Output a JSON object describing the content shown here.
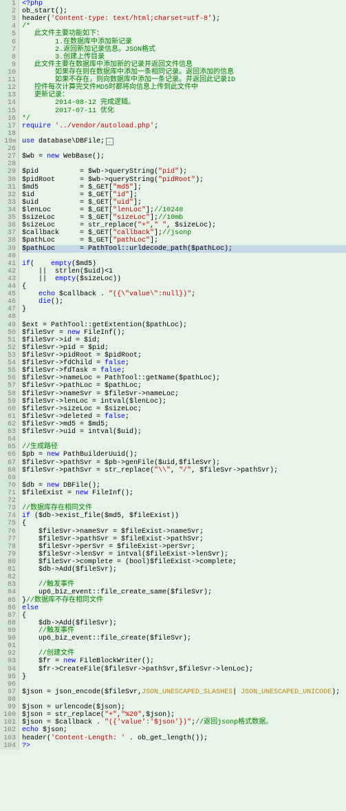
{
  "lines": [
    {
      "n": "1",
      "c": [
        {
          "t": "<?php",
          "s": "kw"
        }
      ]
    },
    {
      "n": "2",
      "c": [
        {
          "t": "ob_start();",
          "s": ""
        }
      ]
    },
    {
      "n": "3",
      "c": [
        {
          "t": "header(",
          "s": ""
        },
        {
          "t": "'Content-type: text/html;charset=utf-8'",
          "s": "str"
        },
        {
          "t": ");",
          "s": ""
        }
      ]
    },
    {
      "n": "4",
      "c": [
        {
          "t": "/*",
          "s": "com"
        }
      ]
    },
    {
      "n": "5",
      "c": [
        {
          "t": "   此文件主要功能如下：",
          "s": "com"
        }
      ]
    },
    {
      "n": "6",
      "c": [
        {
          "t": "        1.在数据库中添加新记录",
          "s": "com"
        }
      ]
    },
    {
      "n": "7",
      "c": [
        {
          "t": "        2.返回新加记录信息。JSON格式",
          "s": "com"
        }
      ]
    },
    {
      "n": "8",
      "c": [
        {
          "t": "        3.创建上传目录",
          "s": "com"
        }
      ]
    },
    {
      "n": "9",
      "c": [
        {
          "t": "   此文件主要在数据库中添加新的记录并返回文件信息",
          "s": "com"
        }
      ]
    },
    {
      "n": "10",
      "c": [
        {
          "t": "        如果存在则在数据库中添加一条相同记录。返回添加的信息",
          "s": "com"
        }
      ]
    },
    {
      "n": "11",
      "c": [
        {
          "t": "        如果不存在，则向数据库中添加一条记录。并返回此记录ID",
          "s": "com"
        }
      ]
    },
    {
      "n": "12",
      "c": [
        {
          "t": "   控件每次计算完文件MD5时都将向信息上传到此文件中",
          "s": "com"
        }
      ]
    },
    {
      "n": "13",
      "c": [
        {
          "t": "   更新记录：",
          "s": "com"
        }
      ]
    },
    {
      "n": "14",
      "c": [
        {
          "t": "        2014-08-12 完成逻辑。",
          "s": "com"
        }
      ]
    },
    {
      "n": "15",
      "c": [
        {
          "t": "        2017-07-11 优化",
          "s": "com"
        }
      ]
    },
    {
      "n": "16",
      "c": [
        {
          "t": "*/",
          "s": "com"
        }
      ]
    },
    {
      "n": "17",
      "c": [
        {
          "t": "require",
          "s": "kw"
        },
        {
          "t": " ",
          "s": ""
        },
        {
          "t": "'../vendor/autoload.php'",
          "s": "str"
        },
        {
          "t": ";",
          "s": ""
        }
      ]
    },
    {
      "n": "18",
      "c": []
    },
    {
      "n": "19",
      "fold": true,
      "c": [
        {
          "t": "use",
          "s": "kw"
        },
        {
          "t": " database\\DBFile;",
          "s": ""
        }
      ]
    },
    {
      "n": "26",
      "c": []
    },
    {
      "n": "27",
      "c": [
        {
          "t": "$wb = ",
          "s": ""
        },
        {
          "t": "new",
          "s": "kw"
        },
        {
          "t": " WebBase();",
          "s": ""
        }
      ]
    },
    {
      "n": "28",
      "c": []
    },
    {
      "n": "29",
      "c": [
        {
          "t": "$pid          = $wb->queryString(",
          "s": ""
        },
        {
          "t": "\"pid\"",
          "s": "str"
        },
        {
          "t": ");",
          "s": ""
        }
      ]
    },
    {
      "n": "30",
      "c": [
        {
          "t": "$pidRoot      = $wb->queryString(",
          "s": ""
        },
        {
          "t": "\"pidRoot\"",
          "s": "str"
        },
        {
          "t": ");",
          "s": ""
        }
      ]
    },
    {
      "n": "31",
      "c": [
        {
          "t": "$md5          = $_GET[",
          "s": ""
        },
        {
          "t": "\"md5\"",
          "s": "str"
        },
        {
          "t": "];",
          "s": ""
        }
      ]
    },
    {
      "n": "32",
      "c": [
        {
          "t": "$id           = $_GET[",
          "s": ""
        },
        {
          "t": "\"id\"",
          "s": "str"
        },
        {
          "t": "];",
          "s": ""
        }
      ]
    },
    {
      "n": "33",
      "c": [
        {
          "t": "$uid          = $_GET[",
          "s": ""
        },
        {
          "t": "\"uid\"",
          "s": "str"
        },
        {
          "t": "];",
          "s": ""
        }
      ]
    },
    {
      "n": "34",
      "c": [
        {
          "t": "$lenLoc       = $_GET[",
          "s": ""
        },
        {
          "t": "\"lenLoc\"",
          "s": "str"
        },
        {
          "t": "];",
          "s": ""
        },
        {
          "t": "//10240",
          "s": "com"
        }
      ]
    },
    {
      "n": "35",
      "c": [
        {
          "t": "$sizeLoc      = $_GET[",
          "s": ""
        },
        {
          "t": "\"sizeLoc\"",
          "s": "str"
        },
        {
          "t": "];",
          "s": ""
        },
        {
          "t": "//10mb",
          "s": "com"
        }
      ]
    },
    {
      "n": "36",
      "c": [
        {
          "t": "$sizeLoc      = str_replace(",
          "s": ""
        },
        {
          "t": "\"+\"",
          "s": "str"
        },
        {
          "t": ",",
          "s": ""
        },
        {
          "t": "\" \"",
          "s": "str"
        },
        {
          "t": ", $sizeLoc);",
          "s": ""
        }
      ]
    },
    {
      "n": "37",
      "c": [
        {
          "t": "$callback     = $_GET[",
          "s": ""
        },
        {
          "t": "\"callback\"",
          "s": "str"
        },
        {
          "t": "];",
          "s": ""
        },
        {
          "t": "//jsonp",
          "s": "com"
        }
      ]
    },
    {
      "n": "38",
      "c": [
        {
          "t": "$pathLoc      = $_GET[",
          "s": ""
        },
        {
          "t": "\"pathLoc\"",
          "s": "str"
        },
        {
          "t": "];",
          "s": ""
        }
      ]
    },
    {
      "n": "39",
      "hl": true,
      "c": [
        {
          "t": "$pathLoc      = PathTool::urldecode_path($pathLoc);",
          "s": ""
        }
      ]
    },
    {
      "n": "40",
      "c": []
    },
    {
      "n": "41",
      "c": [
        {
          "t": "if",
          "s": "kw"
        },
        {
          "t": "(    ",
          "s": ""
        },
        {
          "t": "empty",
          "s": "kw"
        },
        {
          "t": "($md5)",
          "s": ""
        }
      ]
    },
    {
      "n": "42",
      "c": [
        {
          "t": "    ||  strlen($uid)<1",
          "s": ""
        }
      ]
    },
    {
      "n": "43",
      "c": [
        {
          "t": "    ||  ",
          "s": ""
        },
        {
          "t": "empty",
          "s": "kw"
        },
        {
          "t": "($sizeLoc))",
          "s": ""
        }
      ]
    },
    {
      "n": "44",
      "c": [
        {
          "t": "{",
          "s": ""
        }
      ]
    },
    {
      "n": "45",
      "c": [
        {
          "t": "    ",
          "s": ""
        },
        {
          "t": "echo",
          "s": "kw"
        },
        {
          "t": " $callback . ",
          "s": ""
        },
        {
          "t": "\"({\\\"value\\\":null})\"",
          "s": "str"
        },
        {
          "t": ";",
          "s": ""
        }
      ]
    },
    {
      "n": "46",
      "c": [
        {
          "t": "    ",
          "s": ""
        },
        {
          "t": "die",
          "s": "kw"
        },
        {
          "t": "();",
          "s": ""
        }
      ]
    },
    {
      "n": "47",
      "c": [
        {
          "t": "}",
          "s": ""
        }
      ]
    },
    {
      "n": "48",
      "c": []
    },
    {
      "n": "49",
      "c": [
        {
          "t": "$ext = PathTool::getExtention($pathLoc);",
          "s": ""
        }
      ]
    },
    {
      "n": "50",
      "c": [
        {
          "t": "$fileSvr = ",
          "s": ""
        },
        {
          "t": "new",
          "s": "kw"
        },
        {
          "t": " FileInf();",
          "s": ""
        }
      ]
    },
    {
      "n": "51",
      "c": [
        {
          "t": "$fileSvr->id = $id;",
          "s": ""
        }
      ]
    },
    {
      "n": "52",
      "c": [
        {
          "t": "$fileSvr->pid = $pid;",
          "s": ""
        }
      ]
    },
    {
      "n": "53",
      "c": [
        {
          "t": "$fileSvr->pidRoot = $pidRoot;",
          "s": ""
        }
      ]
    },
    {
      "n": "54",
      "c": [
        {
          "t": "$fileSvr->fdChild = ",
          "s": ""
        },
        {
          "t": "false",
          "s": "kw"
        },
        {
          "t": ";",
          "s": ""
        }
      ]
    },
    {
      "n": "55",
      "c": [
        {
          "t": "$fileSvr->fdTask = ",
          "s": ""
        },
        {
          "t": "false",
          "s": "kw"
        },
        {
          "t": ";",
          "s": ""
        }
      ]
    },
    {
      "n": "56",
      "c": [
        {
          "t": "$fileSvr->nameLoc = PathTool::getName($pathLoc);",
          "s": ""
        }
      ]
    },
    {
      "n": "57",
      "c": [
        {
          "t": "$fileSvr->pathLoc = $pathLoc;",
          "s": ""
        }
      ]
    },
    {
      "n": "58",
      "c": [
        {
          "t": "$fileSvr->nameSvr = $fileSvr->nameLoc;",
          "s": ""
        }
      ]
    },
    {
      "n": "59",
      "c": [
        {
          "t": "$fileSvr->lenLoc = intval($lenLoc);",
          "s": ""
        }
      ]
    },
    {
      "n": "60",
      "c": [
        {
          "t": "$fileSvr->sizeLoc = $sizeLoc;",
          "s": ""
        }
      ]
    },
    {
      "n": "61",
      "c": [
        {
          "t": "$fileSvr->deleted = ",
          "s": ""
        },
        {
          "t": "false",
          "s": "kw"
        },
        {
          "t": ";",
          "s": ""
        }
      ]
    },
    {
      "n": "62",
      "c": [
        {
          "t": "$fileSvr->md5 = $md5;",
          "s": ""
        }
      ]
    },
    {
      "n": "63",
      "c": [
        {
          "t": "$fileSvr->uid = intval($uid);",
          "s": ""
        }
      ]
    },
    {
      "n": "64",
      "c": []
    },
    {
      "n": "65",
      "c": [
        {
          "t": "//生成路径",
          "s": "com"
        }
      ]
    },
    {
      "n": "66",
      "c": [
        {
          "t": "$pb = ",
          "s": ""
        },
        {
          "t": "new",
          "s": "kw"
        },
        {
          "t": " PathBuilderUuid();",
          "s": ""
        }
      ]
    },
    {
      "n": "67",
      "c": [
        {
          "t": "$fileSvr->pathSvr = $pb->genFile($uid,$fileSvr);",
          "s": ""
        }
      ]
    },
    {
      "n": "68",
      "c": [
        {
          "t": "$fileSvr->pathSvr = str_replace(",
          "s": ""
        },
        {
          "t": "\"\\\\\"",
          "s": "str"
        },
        {
          "t": ", ",
          "s": ""
        },
        {
          "t": "\"/\"",
          "s": "str"
        },
        {
          "t": ", $fileSvr->pathSvr);",
          "s": ""
        }
      ]
    },
    {
      "n": "69",
      "c": []
    },
    {
      "n": "70",
      "c": [
        {
          "t": "$db = ",
          "s": ""
        },
        {
          "t": "new",
          "s": "kw"
        },
        {
          "t": " DBFile();",
          "s": ""
        }
      ]
    },
    {
      "n": "71",
      "c": [
        {
          "t": "$fileExist = ",
          "s": ""
        },
        {
          "t": "new",
          "s": "kw"
        },
        {
          "t": " FileInf();",
          "s": ""
        }
      ]
    },
    {
      "n": "72",
      "c": []
    },
    {
      "n": "73",
      "c": [
        {
          "t": "//数据库存在相同文件",
          "s": "com"
        }
      ]
    },
    {
      "n": "74",
      "c": [
        {
          "t": "if",
          "s": "kw"
        },
        {
          "t": " ($db->exist_file($md5, $fileExist))",
          "s": ""
        }
      ]
    },
    {
      "n": "75",
      "c": [
        {
          "t": "{",
          "s": ""
        }
      ]
    },
    {
      "n": "76",
      "c": [
        {
          "t": "    $fileSvr->nameSvr = $fileExist->nameSvr;",
          "s": ""
        }
      ]
    },
    {
      "n": "77",
      "c": [
        {
          "t": "    $fileSvr->pathSvr = $fileExist->pathSvr;",
          "s": ""
        }
      ]
    },
    {
      "n": "78",
      "c": [
        {
          "t": "    $fileSvr->perSvr = $fileExist->perSvr;",
          "s": ""
        }
      ]
    },
    {
      "n": "79",
      "c": [
        {
          "t": "    $fileSvr->lenSvr = intval($fileExist->lenSvr);",
          "s": ""
        }
      ]
    },
    {
      "n": "80",
      "c": [
        {
          "t": "    $fileSvr->complete = (bool)$fileExist->complete;",
          "s": ""
        }
      ]
    },
    {
      "n": "81",
      "c": [
        {
          "t": "    $db->Add($fileSvr);",
          "s": ""
        }
      ]
    },
    {
      "n": "82",
      "c": []
    },
    {
      "n": "83",
      "c": [
        {
          "t": "    ",
          "s": ""
        },
        {
          "t": "//触发事件",
          "s": "com"
        }
      ]
    },
    {
      "n": "84",
      "c": [
        {
          "t": "    up6_biz_event::file_create_same($fileSvr);",
          "s": ""
        }
      ]
    },
    {
      "n": "85",
      "c": [
        {
          "t": "}",
          "s": ""
        },
        {
          "t": "//数据库不存在相同文件",
          "s": "com"
        }
      ]
    },
    {
      "n": "86",
      "c": [
        {
          "t": "else",
          "s": "kw"
        }
      ]
    },
    {
      "n": "87",
      "c": [
        {
          "t": "{",
          "s": ""
        }
      ]
    },
    {
      "n": "88",
      "c": [
        {
          "t": "    $db->Add($fileSvr);",
          "s": ""
        }
      ]
    },
    {
      "n": "89",
      "c": [
        {
          "t": "    ",
          "s": ""
        },
        {
          "t": "//触发事件",
          "s": "com"
        }
      ]
    },
    {
      "n": "90",
      "c": [
        {
          "t": "    up6_biz_event::file_create($fileSvr);",
          "s": ""
        }
      ]
    },
    {
      "n": "91",
      "c": []
    },
    {
      "n": "92",
      "c": [
        {
          "t": "    ",
          "s": ""
        },
        {
          "t": "//创建文件",
          "s": "com"
        }
      ]
    },
    {
      "n": "93",
      "c": [
        {
          "t": "    $fr = ",
          "s": ""
        },
        {
          "t": "new",
          "s": "kw"
        },
        {
          "t": " FileBlockWriter();",
          "s": ""
        }
      ]
    },
    {
      "n": "94",
      "c": [
        {
          "t": "    $fr->CreateFile($fileSvr->pathSvr,$fileSvr->lenLoc);",
          "s": ""
        }
      ]
    },
    {
      "n": "95",
      "c": [
        {
          "t": "}",
          "s": ""
        }
      ]
    },
    {
      "n": "96",
      "c": []
    },
    {
      "n": "97",
      "c": [
        {
          "t": "$json = json_encode($fileSvr,",
          "s": ""
        },
        {
          "t": "JSON_UNESCAPED_SLASHES",
          "s": "cc"
        },
        {
          "t": "| ",
          "s": ""
        },
        {
          "t": "JSON_UNESCAPED_UNICODE",
          "s": "cc"
        },
        {
          "t": ");",
          "s": ""
        }
      ]
    },
    {
      "n": "98",
      "c": []
    },
    {
      "n": "99",
      "c": [
        {
          "t": "$json = urlencode($json);",
          "s": ""
        }
      ]
    },
    {
      "n": "100",
      "c": [
        {
          "t": "$json = str_replace(",
          "s": ""
        },
        {
          "t": "\"+\"",
          "s": "str"
        },
        {
          "t": ",",
          "s": ""
        },
        {
          "t": "\"%20\"",
          "s": "str"
        },
        {
          "t": ",$json);",
          "s": ""
        }
      ]
    },
    {
      "n": "101",
      "c": [
        {
          "t": "$json = $callback . ",
          "s": ""
        },
        {
          "t": "\"({'value':'$json'})\"",
          "s": "str"
        },
        {
          "t": ";",
          "s": ""
        },
        {
          "t": "//返回jsonp格式数据。",
          "s": "com"
        }
      ]
    },
    {
      "n": "102",
      "c": [
        {
          "t": "echo",
          "s": "kw"
        },
        {
          "t": " $json;",
          "s": ""
        }
      ]
    },
    {
      "n": "103",
      "c": [
        {
          "t": "header(",
          "s": ""
        },
        {
          "t": "'Content-Length: '",
          "s": "str"
        },
        {
          "t": " . ob_get_length());",
          "s": ""
        }
      ]
    },
    {
      "n": "104",
      "c": [
        {
          "t": "?>",
          "s": "kw"
        }
      ]
    }
  ]
}
